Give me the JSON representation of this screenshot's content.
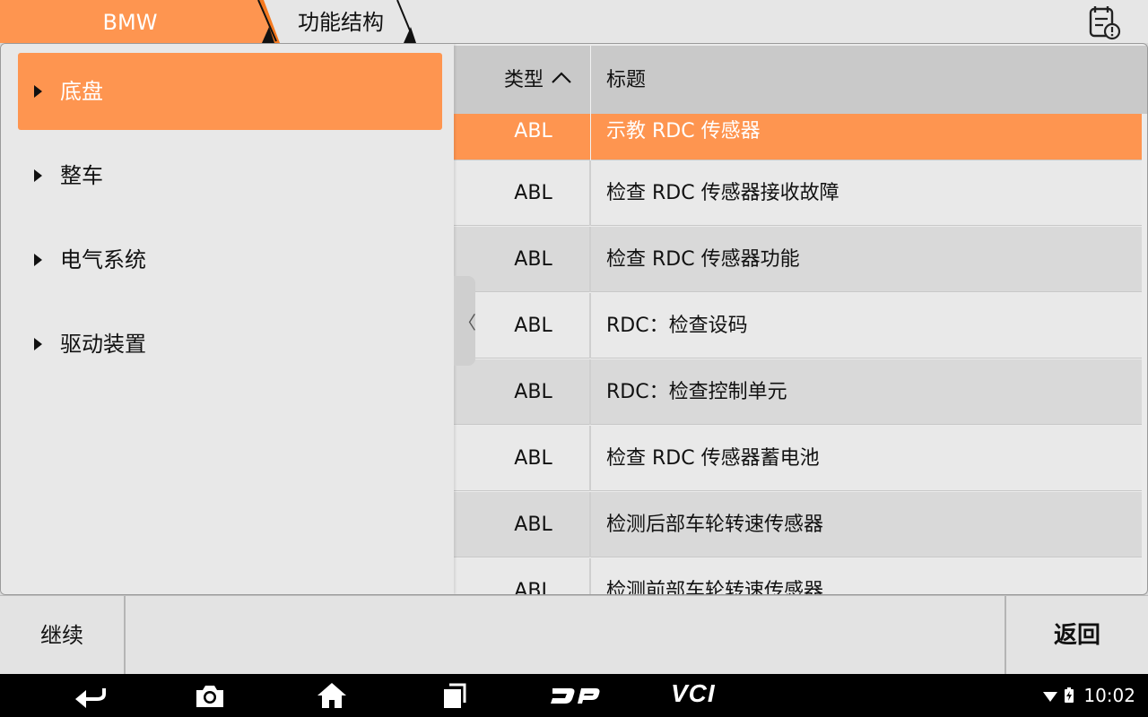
{
  "breadcrumb": {
    "root": "BMW",
    "current": "功能结构"
  },
  "colors": {
    "accent": "#fe9550",
    "accent_dark": "#f57a20"
  },
  "drawer": {
    "items": [
      {
        "label": "底盘",
        "active": true
      },
      {
        "label": "整车"
      },
      {
        "label": "电气系统"
      },
      {
        "label": "驱动装置"
      }
    ]
  },
  "table": {
    "headers": {
      "type": "类型",
      "title": "标题"
    },
    "sort": "ascending",
    "rows": [
      {
        "type": "ABL",
        "title": "示教 RDC 传感器"
      },
      {
        "type": "ABL",
        "title": "检查 RDC 传感器接收故障"
      },
      {
        "type": "ABL",
        "title": "检查 RDC 传感器功能"
      },
      {
        "type": "ABL",
        "title": "RDC：检查设码"
      },
      {
        "type": "ABL",
        "title": "RDC：检查控制单元"
      },
      {
        "type": "ABL",
        "title": "检查 RDC 传感器蓄电池"
      },
      {
        "type": "ABL",
        "title": "检测后部车轮转速传感器"
      },
      {
        "type": "ABL",
        "title": "检测前部车轮转速传感器"
      }
    ]
  },
  "actions": {
    "continue": "继续",
    "back": "返回"
  },
  "navbar": {
    "buttons": [
      "back-icon",
      "camera-icon",
      "home-icon",
      "recent-apps-icon",
      "dp-icon",
      "vci-icon"
    ],
    "vci_label": "VCI",
    "time": "10:02"
  }
}
